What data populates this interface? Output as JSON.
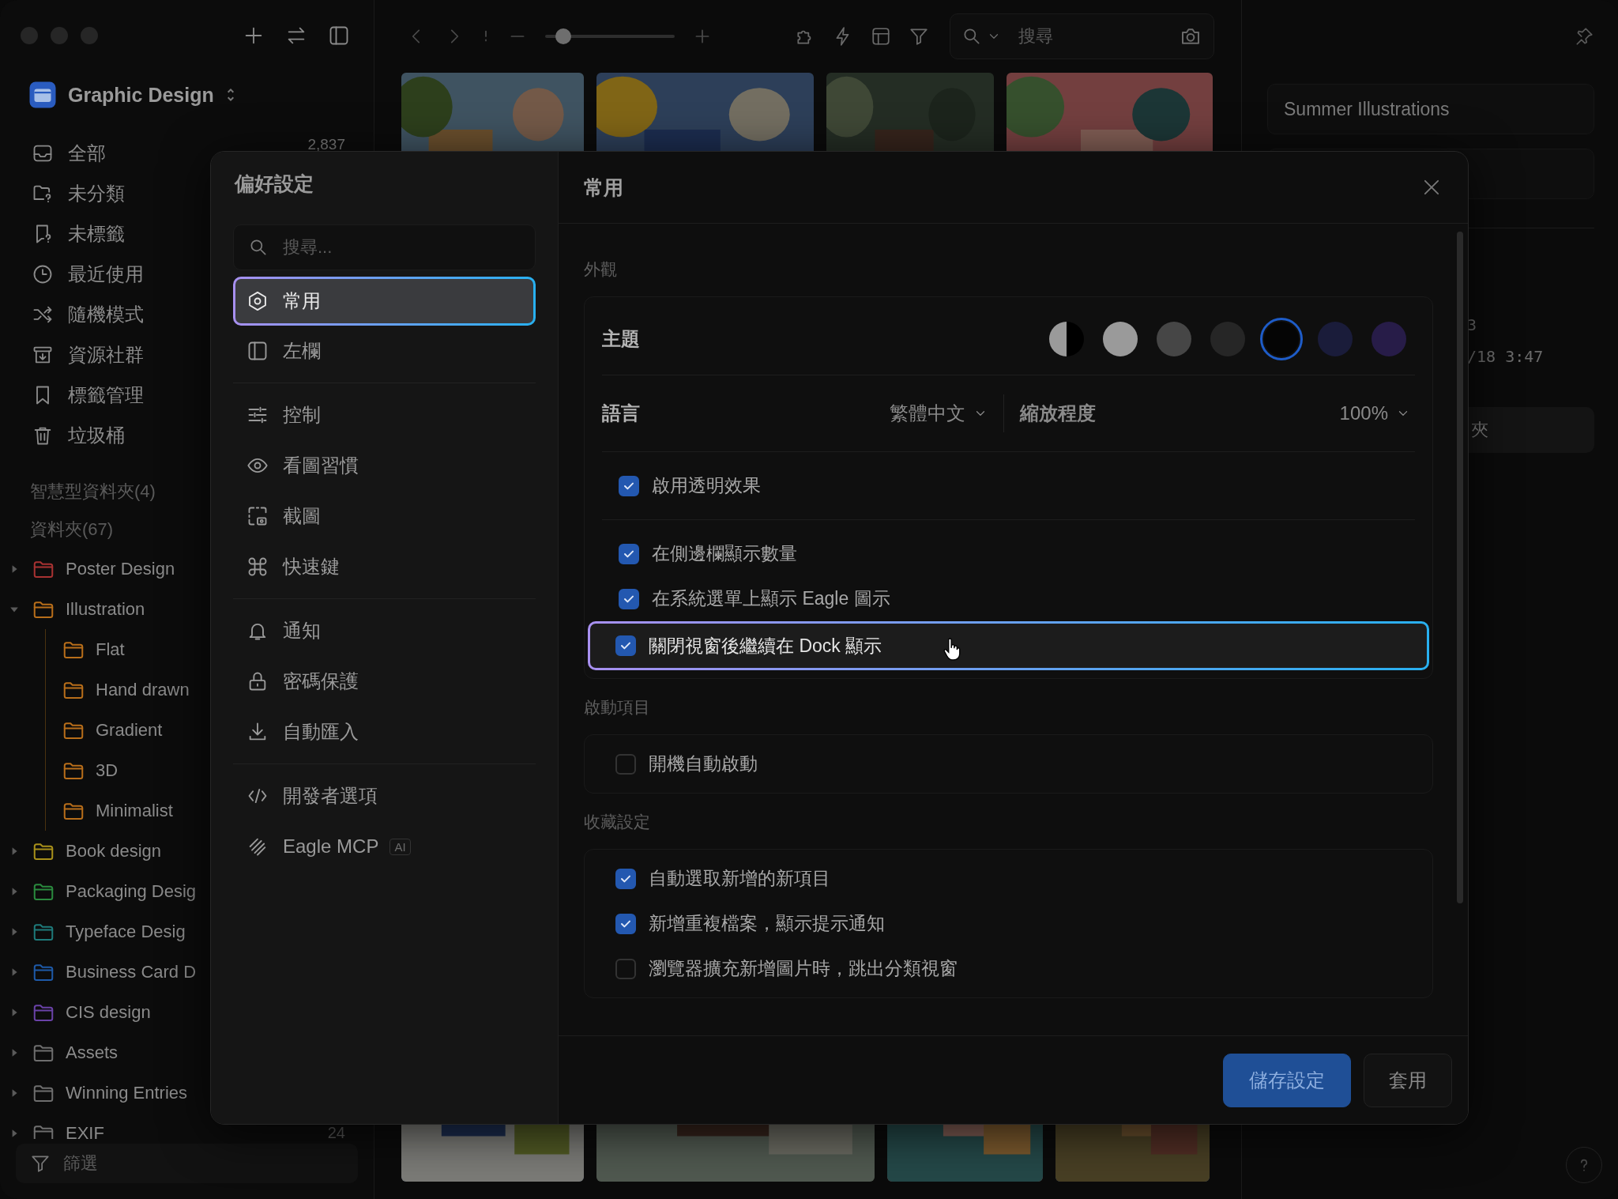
{
  "sidebar": {
    "library": "Graphic Design",
    "items": [
      {
        "label": "全部",
        "count": "2,837",
        "selected": false
      },
      {
        "label": "未分類",
        "selected": false
      },
      {
        "label": "未標籤",
        "selected": false
      },
      {
        "label": "最近使用",
        "selected": false
      },
      {
        "label": "隨機模式",
        "selected": false
      },
      {
        "label": "資源社群",
        "selected": false
      },
      {
        "label": "標籤管理",
        "selected": false
      },
      {
        "label": "垃圾桶",
        "selected": false
      }
    ],
    "smart_folders": "智慧型資料夾(4)",
    "folders_heading": "資料夾(67)",
    "folders": [
      {
        "name": "Poster Design",
        "color": "#a83232",
        "expanded": false
      },
      {
        "name": "Illustration",
        "color": "#b86e1a",
        "expanded": true,
        "children": [
          {
            "name": "Flat",
            "color": "#b86e1a"
          },
          {
            "name": "Hand drawn",
            "color": "#b86e1a"
          },
          {
            "name": "Gradient",
            "color": "#b86e1a"
          },
          {
            "name": "3D",
            "color": "#b86e1a"
          },
          {
            "name": "Minimalist",
            "color": "#b86e1a"
          }
        ]
      },
      {
        "name": "Book design",
        "color": "#a8901a",
        "expanded": false
      },
      {
        "name": "Packaging Desig",
        "color": "#2a8a3e",
        "expanded": false
      },
      {
        "name": "Typeface Desig",
        "color": "#1e7a7a",
        "expanded": false
      },
      {
        "name": "Business Card D",
        "color": "#1e5aa8",
        "expanded": false
      },
      {
        "name": "CIS design",
        "color": "#6a42a8",
        "expanded": false
      },
      {
        "name": "Assets",
        "color": "#6e6e6e",
        "expanded": false
      },
      {
        "name": "Winning Entries",
        "color": "#6e6e6e",
        "expanded": false
      },
      {
        "name": "EXIF",
        "count": "24",
        "color": "#6e6e6e",
        "expanded": false
      }
    ],
    "filter": {
      "placeholder": "篩選"
    }
  },
  "toolbar": {
    "zoom": {
      "level": 0.14
    },
    "search": {
      "placeholder": "搜尋"
    }
  },
  "inspector": {
    "name": "Summer Illustrations",
    "info": [
      "3",
      "/18 3:47"
    ],
    "folder_button": "夾"
  },
  "preferences": {
    "title": "偏好設定",
    "search": {
      "placeholder": "搜尋..."
    },
    "nav": [
      [
        {
          "label": "常用",
          "selected": true
        },
        {
          "label": "左欄",
          "selected": false
        }
      ],
      [
        {
          "label": "控制",
          "selected": false
        },
        {
          "label": "看圖習慣",
          "selected": false
        },
        {
          "label": "截圖",
          "selected": false
        },
        {
          "label": "快速鍵",
          "selected": false
        }
      ],
      [
        {
          "label": "通知",
          "selected": false
        },
        {
          "label": "密碼保護",
          "selected": false
        },
        {
          "label": "自動匯入",
          "selected": false
        }
      ],
      [
        {
          "label": "開發者選項",
          "selected": false
        },
        {
          "label": "Eagle MCP",
          "badge": "AI",
          "selected": false
        }
      ]
    ],
    "page_title": "常用",
    "appearance": {
      "heading": "外觀",
      "theme_label": "主題",
      "themes": [
        {
          "kind": "split",
          "color": "#9a9a9a",
          "selected": false
        },
        {
          "kind": "solid",
          "color": "#9a9a9a",
          "selected": false
        },
        {
          "kind": "solid",
          "color": "#464646",
          "selected": false
        },
        {
          "kind": "solid",
          "color": "#262626",
          "selected": false
        },
        {
          "kind": "solid",
          "color": "#050505",
          "selected": true
        },
        {
          "kind": "solid",
          "color": "#1a1c3a",
          "selected": false
        },
        {
          "kind": "solid",
          "color": "#271c48",
          "selected": false
        }
      ],
      "language_label": "語言",
      "language": "繁體中文",
      "zoom_label": "縮放程度",
      "zoom": "100%",
      "groups": [
        [
          {
            "label": "啟用透明效果",
            "checked": true,
            "focused": false
          }
        ],
        [
          {
            "label": "在側邊欄顯示數量",
            "checked": true,
            "focused": false
          },
          {
            "label": "在系統選單上顯示 Eagle 圖示",
            "checked": true,
            "focused": false
          },
          {
            "label": "關閉視窗後繼續在 Dock 顯示",
            "checked": true,
            "focused": true
          }
        ]
      ]
    },
    "sections": [
      {
        "heading": "啟動項目",
        "options": [
          {
            "label": "開機自動啟動",
            "checked": false,
            "focused": false
          }
        ]
      },
      {
        "heading": "收藏設定",
        "options": [
          {
            "label": "自動選取新增的新項目",
            "checked": true,
            "focused": false
          },
          {
            "label": "新增重複檔案，顯示提示通知",
            "checked": true,
            "focused": false
          },
          {
            "label": "瀏覽器擴充新增圖片時，跳出分類視窗",
            "checked": false,
            "focused": false
          }
        ]
      }
    ],
    "buttons": [
      {
        "label": "儲存設定",
        "kind": "primary"
      },
      {
        "label": "套用",
        "kind": "secondary"
      }
    ]
  }
}
